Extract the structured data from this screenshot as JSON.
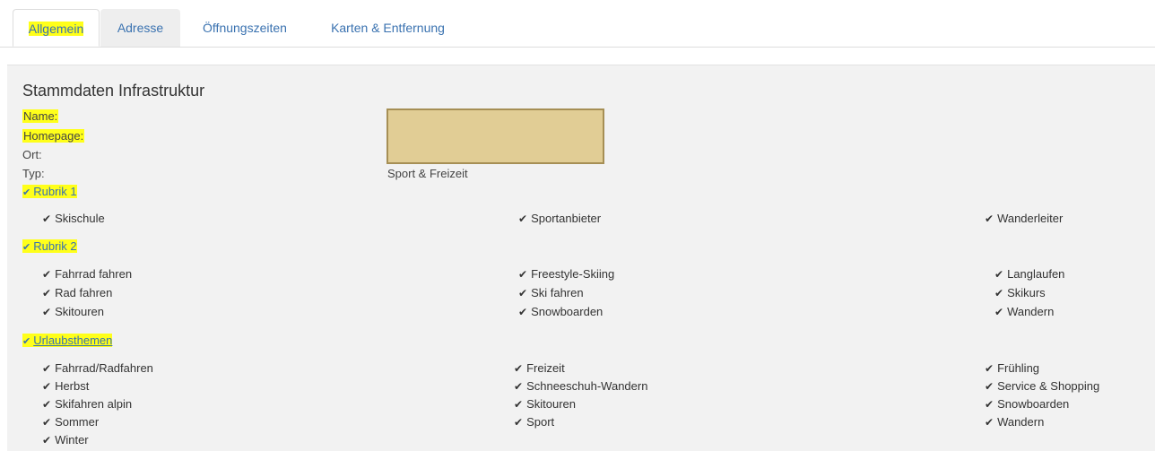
{
  "tabs": [
    {
      "label": "Allgemein",
      "active": true
    },
    {
      "label": "Adresse",
      "active": false
    },
    {
      "label": "Öffnungszeiten",
      "active": false
    },
    {
      "label": "Karten & Entfernung",
      "active": false
    }
  ],
  "panel": {
    "title": "Stammdaten Infrastruktur",
    "fields": {
      "name_label": "Name:",
      "homepage_label": "Homepage:",
      "ort_label": "Ort:",
      "typ_label": "Typ:",
      "typ_value": "Sport & Freizeit"
    },
    "image_placeholder_color": "#e1cd95"
  },
  "sections": [
    {
      "label": "Rubrik 1",
      "items": [
        "Skischule",
        "Sportanbieter",
        "Wanderleiter"
      ]
    },
    {
      "label": "Rubrik 2",
      "items": [
        "Fahrrad fahren",
        "Freestyle-Skiing",
        "Langlaufen",
        "Rad fahren",
        "Ski fahren",
        "Skikurs",
        "Skitouren",
        "Snowboarden",
        "Wandern"
      ]
    },
    {
      "label": "Urlaubsthemen",
      "items": [
        "Fahrrad/Radfahren",
        "Freizeit",
        "Frühling",
        "Herbst",
        "Schneeschuh-Wandern",
        "Service & Shopping",
        "Skifahren alpin",
        "Skitouren",
        "Snowboarden",
        "Sommer",
        "Sport",
        "Wandern",
        "Winter"
      ]
    }
  ],
  "icons": {
    "check": "check-icon",
    "chevron": "chevron-down-icon"
  },
  "colors": {
    "highlight": "#ffff1a",
    "link": "#3a72b0",
    "panel_bg": "#f2f2f2"
  }
}
